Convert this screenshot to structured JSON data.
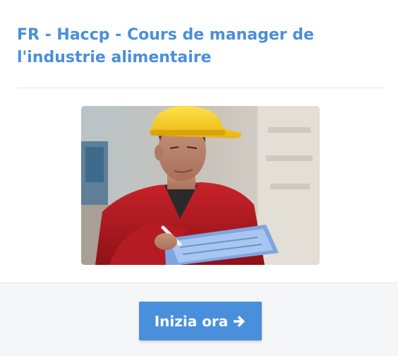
{
  "course": {
    "title": "FR - Haccp - Cours de manager de l'industrie alimentaire",
    "image_subject": "worker-with-hard-hat-and-clipboard"
  },
  "cta": {
    "label": "Inizia ora",
    "icon": "arrow-right-icon"
  },
  "colors": {
    "accent": "#4a8fdb",
    "footer_bg": "#f5f6f8",
    "divider": "#e4e6ea"
  }
}
